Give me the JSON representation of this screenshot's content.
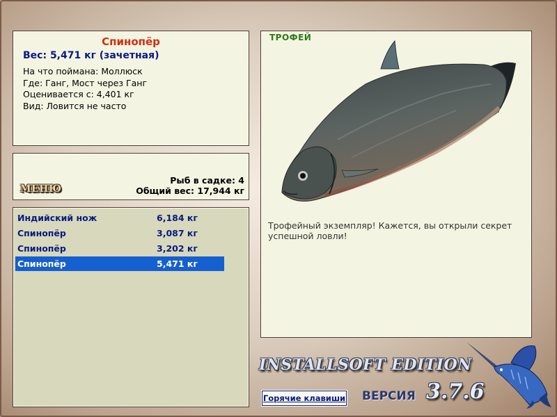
{
  "info": {
    "fish_name": "Спинопёр",
    "weight_line": "Вес: 5,471 кг (зачетная)",
    "caught_on": "На что поймана: Моллюск",
    "location": "Где: Ганг, Мост через Ганг",
    "rated_from": "Оценивается с: 4,401 кг",
    "rarity": "Вид: Ловится не часто"
  },
  "status": {
    "menu_label": "МЕНЮ",
    "fish_count": "Рыб в садке: 4",
    "total_weight": "Общий вес: 17,944 кг"
  },
  "catch_list": [
    {
      "name": "Индийский нож",
      "weight": "6,184 кг",
      "selected": false
    },
    {
      "name": "Спинопёр",
      "weight": "3,087 кг",
      "selected": false
    },
    {
      "name": "Спинопёр",
      "weight": "3,202 кг",
      "selected": false
    },
    {
      "name": "Спинопёр",
      "weight": "5,471 кг",
      "selected": true
    }
  ],
  "trophy": {
    "tag": "ТРОФЕЙ",
    "description": "Трофейный экземпляр! Кажется, вы открыли секрет успешной ловли!"
  },
  "footer": {
    "edition": "INSTALLSOFT EDITION",
    "hotkeys_label": "Горячие клавиши",
    "version_label": "ВЕРСИЯ",
    "version_number": "3.7.6"
  },
  "icons": {
    "fish_image": "catfish-image",
    "logo": "marlin-icon"
  },
  "colors": {
    "fish_name": "#d03010",
    "weight": "#0a1a80",
    "list_text": "#0a1a80",
    "selection": "#1560d0",
    "trophy_tag": "#2a7a18",
    "panel_bg": "#f4f4e2"
  }
}
